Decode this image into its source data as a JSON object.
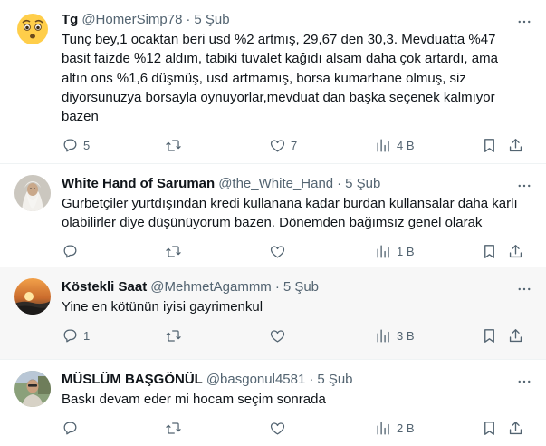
{
  "tweets": [
    {
      "name": "Tg",
      "handle": "@HomerSimp78",
      "time": "5 Şub",
      "avatar": "worried-emoji-avatar",
      "text": "Tunç bey,1 ocaktan beri usd %2 artmış, 29,67 den 30,3. Mevduatta %47 basit faizde %12 aldım, tabiki tuvalet kağıdı alsam daha çok artardı, ama altın ons %1,6 düşmüş, usd artmamış, borsa kumarhane olmuş, siz diyorsunuzya borsayla oynuyorlar,mevduat dan başka seçenek kalmıyor bazen",
      "replies": "5",
      "retweets": "",
      "likes": "7",
      "views": "4 B"
    },
    {
      "name": "White Hand of Saruman",
      "handle": "@the_White_Hand",
      "time": "5 Şub",
      "avatar": "saruman-avatar",
      "text": "Gurbetçiler yurtdışından kredi kullanana kadar burdan kullansalar daha karlı olabilirler diye düşünüyorum bazen. Dönemden bağımsız genel olarak",
      "replies": "",
      "retweets": "",
      "likes": "",
      "views": "1 B"
    },
    {
      "name": "Köstekli Saat",
      "handle": "@MehmetAgammm",
      "time": "5 Şub",
      "avatar": "sunset-avatar",
      "text": "Yine en kötünün iyisi gayrimenkul",
      "replies": "1",
      "retweets": "",
      "likes": "",
      "views": "3 B"
    },
    {
      "name": "MÜSLÜM BAŞGÖNÜL",
      "handle": "@basgonul4581",
      "time": "5 Şub",
      "avatar": "man-photo-avatar",
      "text": "Baskı devam eder mi hocam seçim sonrada",
      "replies": "",
      "retweets": "",
      "likes": "",
      "views": "2 B"
    }
  ],
  "icons": {
    "reply": "reply-icon",
    "retweet": "retweet-icon",
    "like": "like-icon",
    "views": "views-icon",
    "bookmark": "bookmark-icon",
    "share": "share-icon",
    "more": "more-icon"
  },
  "colors": {
    "text": "#0f1419",
    "muted": "#536471",
    "hover_bg": "#f7f7f7",
    "divider": "#eff3f4"
  }
}
